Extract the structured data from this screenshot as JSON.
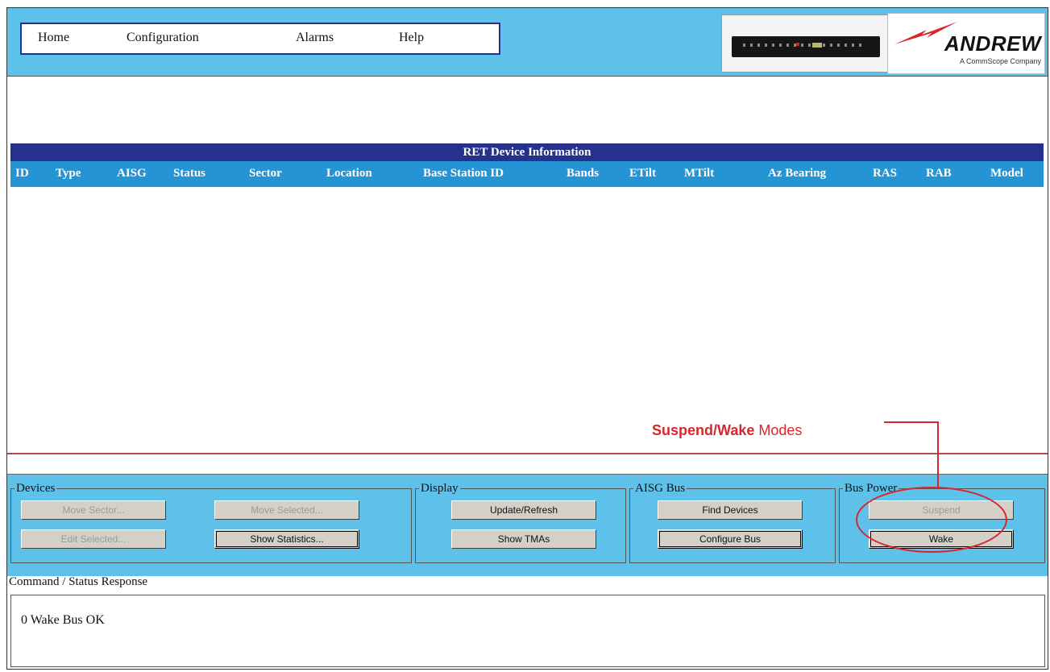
{
  "menu": {
    "home": "Home",
    "configuration": "Configuration",
    "alarms": "Alarms",
    "help": "Help"
  },
  "logo": {
    "name": "ANDREW",
    "tagline": "A CommScope Company"
  },
  "table": {
    "title": "RET Device Information",
    "columns": [
      "ID",
      "Type",
      "AISG",
      "Status",
      "Sector",
      "Location",
      "Base Station ID",
      "Bands",
      "ETilt",
      "MTilt",
      "Az Bearing",
      "RAS",
      "RAB",
      "Model"
    ]
  },
  "annotation": {
    "bold": "Suspend/Wake",
    "rest": " Modes"
  },
  "devices": {
    "label": "Devices",
    "move_sector": "Move Sector...",
    "move_selected": "Move Selected...",
    "edit_selected": "Edit Selected...",
    "show_statistics": "Show Statistics..."
  },
  "display": {
    "label": "Display",
    "update_refresh": "Update/Refresh",
    "show_tmas": "Show TMAs"
  },
  "aisg_bus": {
    "label": "AISG Bus",
    "find_devices": "Find Devices",
    "configure_bus": "Configure Bus"
  },
  "bus_power": {
    "label": "Bus Power",
    "suspend": "Suspend",
    "wake": "Wake"
  },
  "status": {
    "label": "Command / Status Response",
    "text": "0 Wake Bus OK"
  },
  "colors": {
    "panel_blue": "#5ec1ea",
    "title_navy": "#25318d",
    "header_blue": "#2594d4",
    "annotation_red": "#d8262c"
  }
}
